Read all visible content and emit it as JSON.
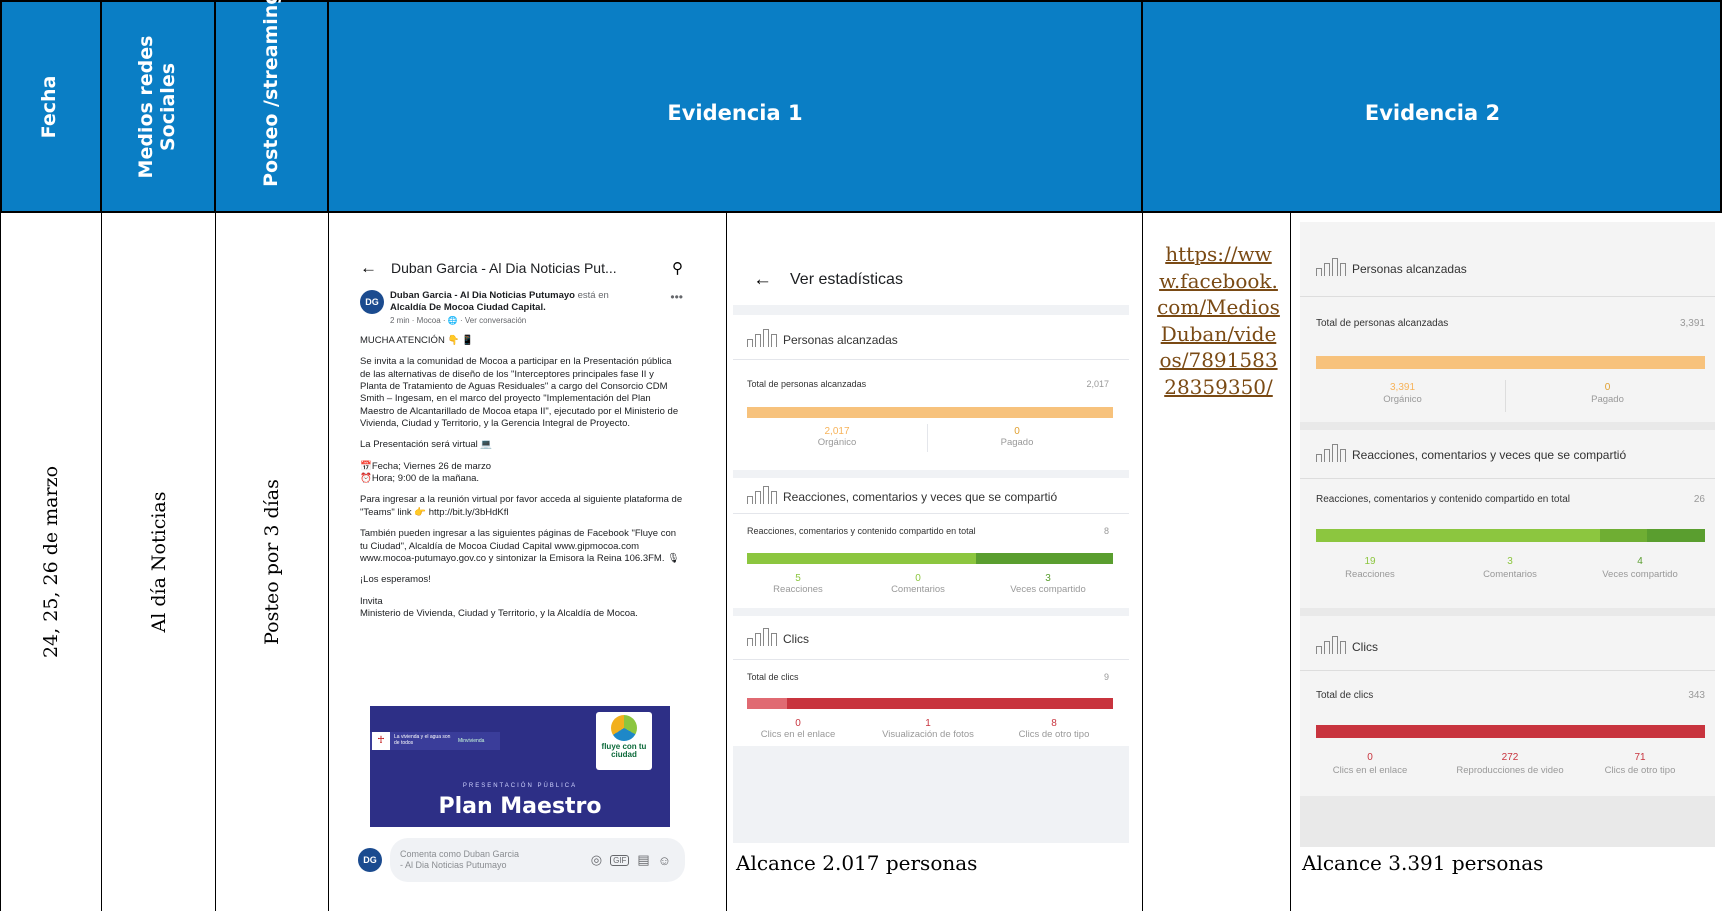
{
  "header": {
    "col_fecha": "Fecha",
    "col_medios": "Medios redes Sociales",
    "col_posteo": "Posteo /streaming",
    "col_evidencia1": "Evidencia 1",
    "col_evidencia2": "Evidencia 2"
  },
  "row": {
    "fecha": "24, 25, 26 de marzo",
    "medio": "Al día Noticias",
    "posteo": "Posteo por 3 días",
    "link": "https://www.facebook.com/MediosDuban/videos/789158328359350/"
  },
  "post": {
    "page_title": "Duban Garcia - Al Dia Noticias Put...",
    "author": "Duban Garcia - Al Dia Noticias Putumayo",
    "author_suffix": " está en",
    "place": "Alcaldía De Mocoa Ciudad Capital.",
    "meta": "2 min · Mocoa · 🌐 · Ver conversación",
    "line1": "MUCHA ATENCIÓN 👇 📱",
    "para1": "Se invita a la comunidad de Mocoa a participar en la Presentación pública de las alternativas de diseño de los \"Interceptores principales fase II y Planta de Tratamiento de Aguas Residuales\" a cargo del Consorcio CDM Smith – Ingesam, en el marco del proyecto \"Implementación del Plan Maestro de Alcantarillado de Mocoa etapa II\", ejecutado por el Ministerio de Vivienda, Ciudad y Territorio, y la Gerencia Integral de Proyecto.",
    "para2": "La Presentación será virtual 💻",
    "para3a": "📅Fecha; Viernes 26 de marzo",
    "para3b": "⏰Hora; 9:00 de la mañana.",
    "para4": "Para ingresar a la reunión virtual por favor acceda al siguiente plataforma de \"Teams\" link 👉 http://bit.ly/3bHdKfl",
    "para5": "También pueden ingresar a las siguientes páginas de Facebook \"Fluye con tu Ciudad\", Alcaldía de Mocoa Ciudad Capital www.gipmocoa.com www.mocoa-putumayo.gov.co y sintonizar la Emisora la Reina 106.3FM. 🎙",
    "para6": "¡Los esperamos!",
    "para7a": "Invita",
    "para7b": "Ministerio de Vivienda, Ciudad y Territorio, y la Alcaldía de Mocoa.",
    "banner_small": "PRESENTACIÓN PÚBLICA",
    "banner_big": "Plan Maestro",
    "banner_slogan": "La vivienda y el agua son de todos",
    "banner_ministerio": "Minvivienda",
    "banner_brand": "fluye con tu ciudad",
    "comment_placeholder": "Comenta como Duban Garcia - Al Dia Noticias Putumayo",
    "avatar_text": "DG"
  },
  "stats1": {
    "back_title": "Ver estadísticas",
    "reach_title": "Personas alcanzadas",
    "reach_total_label": "Total de personas alcanzadas",
    "reach_total": "2,017",
    "organic": "2,017",
    "organic_label": "Orgánico",
    "paid": "0",
    "paid_label": "Pagado",
    "react_title": "Reacciones, comentarios y veces que se compartió",
    "react_total_label": "Reacciones, comentarios y contenido compartido en total",
    "react_total": "8",
    "reactions": "5",
    "reactions_label": "Reacciones",
    "comments": "0",
    "comments_label": "Comentarios",
    "shares": "3",
    "shares_label": "Veces compartido",
    "clicks_title": "Clics",
    "clicks_total_label": "Total de clics",
    "clicks_total": "9",
    "link_clicks": "0",
    "link_clicks_label": "Clics en el enlace",
    "photo_views": "1",
    "photo_views_label": "Visualización de fotos",
    "other_clicks": "8",
    "other_clicks_label": "Clics de otro tipo",
    "caption": "Alcance 2.017 personas"
  },
  "stats2": {
    "reach_title": "Personas alcanzadas",
    "reach_total_label": "Total de personas alcanzadas",
    "reach_total": "3,391",
    "organic": "3,391",
    "organic_label": "Orgánico",
    "paid": "0",
    "paid_label": "Pagado",
    "react_title": "Reacciones, comentarios y veces que se compartió",
    "react_total_label": "Reacciones, comentarios y contenido compartido en total",
    "react_total": "26",
    "reactions": "19",
    "reactions_label": "Reacciones",
    "comments": "3",
    "comments_label": "Comentarios",
    "shares": "4",
    "shares_label": "Veces compartido",
    "clicks_title": "Clics",
    "clicks_total_label": "Total de clics",
    "clicks_total": "343",
    "link_clicks": "0",
    "link_clicks_label": "Clics en el enlace",
    "video_plays": "272",
    "video_plays_label": "Reproducciones de video",
    "other_clicks": "71",
    "other_clicks_label": "Clics de otro tipo",
    "caption": "Alcance 3.391 personas"
  },
  "colors": {
    "header_bg": "#0a7ec5",
    "organic_bar": "#f7c27c",
    "react_bar": "#8cc63f",
    "react_bar_dark": "#5a9e2f",
    "click_bar": "#c8343e",
    "link_color": "#7a4a14"
  }
}
